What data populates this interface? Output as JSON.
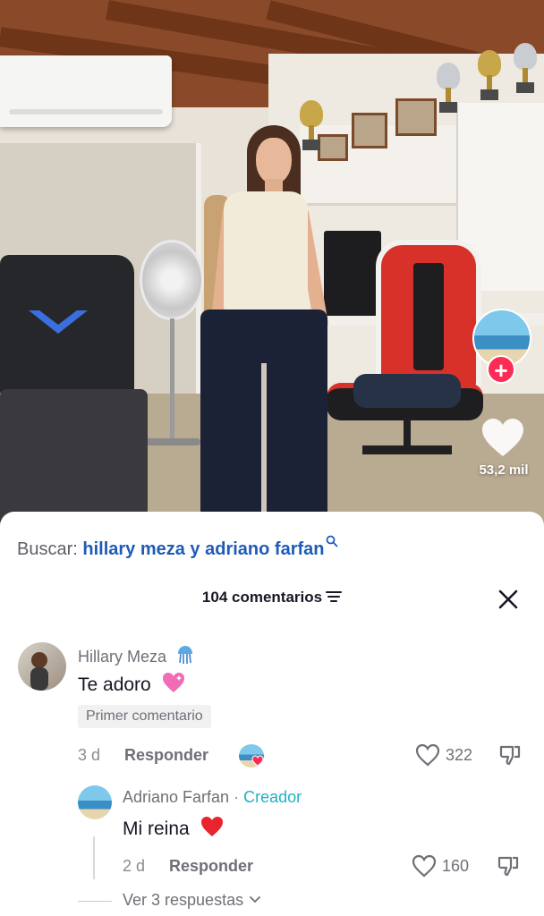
{
  "video": {
    "like_count": "53,2 mil",
    "icons": [
      "creator-avatar-icon",
      "follow-plus-icon",
      "heart-icon"
    ]
  },
  "search": {
    "label": "Buscar:",
    "query": "hillary meza y adriano farfan"
  },
  "comments_header": {
    "count_label": "104 comentarios"
  },
  "comments": [
    {
      "author": "Hillary Meza",
      "text": "Te adoro",
      "badge": "Primer comentario",
      "time": "3 d",
      "reply_label": "Responder",
      "likes": "322"
    }
  ],
  "reply": {
    "author": "Adriano Farfan",
    "separator": "·",
    "creator_label": "Creador",
    "text": "Mi reina",
    "time": "2 d",
    "reply_label": "Responder",
    "likes": "160"
  },
  "more_replies": "Ver 3 respuestas",
  "colors": {
    "accent_red": "#fe2c55",
    "link_blue": "#1e5bb8",
    "creator_teal": "#20b0c8"
  }
}
